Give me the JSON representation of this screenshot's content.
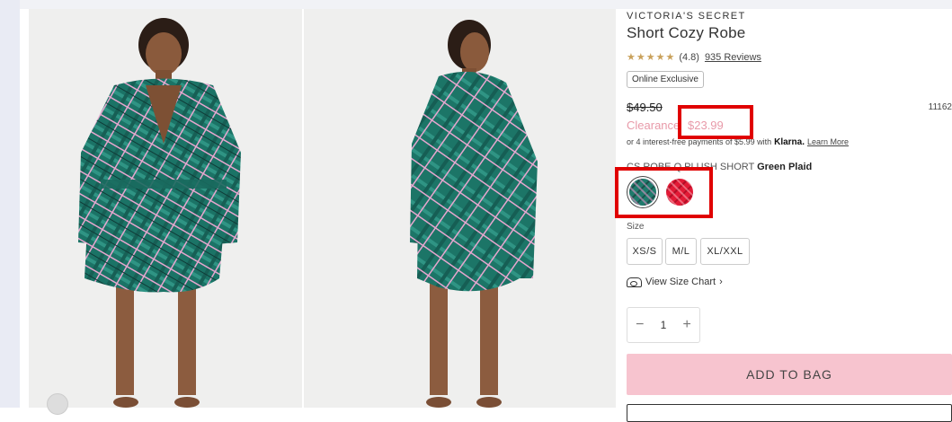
{
  "product": {
    "brand": "VICTORIA'S SECRET",
    "title": "Short Cozy Robe",
    "rating": {
      "stars": "★★★★★",
      "value": "(4.8)",
      "reviews": "935 Reviews"
    },
    "badge": "Online Exclusive",
    "price_original": "$49.50",
    "sku": "11162",
    "clearance_label": "Clearance",
    "clearance_price": "$23.99",
    "klarna": {
      "text": "or 4 interest-free payments of $5.99 with",
      "brand": "Klarna.",
      "link": "Learn More"
    },
    "style": {
      "code": "CS ROBE Q PLUSH SHORT",
      "color": "Green Plaid"
    },
    "swatches": [
      {
        "name": "Green Plaid",
        "color": "#1f7a6c",
        "selected": true
      },
      {
        "name": "Red Plaid",
        "color": "#e21a36",
        "selected": false
      }
    ],
    "size_label": "Size",
    "sizes": [
      "XS/S",
      "M/L",
      "XL/XXL"
    ],
    "size_chart": "View Size Chart",
    "size_chart_chevron": "›",
    "quantity": {
      "minus": "−",
      "value": "1",
      "plus": "+"
    },
    "add_to_bag": "ADD TO BAG"
  },
  "colors": {
    "clearance": "#e89aa9",
    "add_to_bag_bg": "#f7c4cf",
    "highlight": "#e00000",
    "rating_stars": "#c9a15b"
  },
  "icons": [
    "measuring-tape-icon",
    "chevron-right-icon",
    "minus-icon",
    "plus-icon"
  ]
}
